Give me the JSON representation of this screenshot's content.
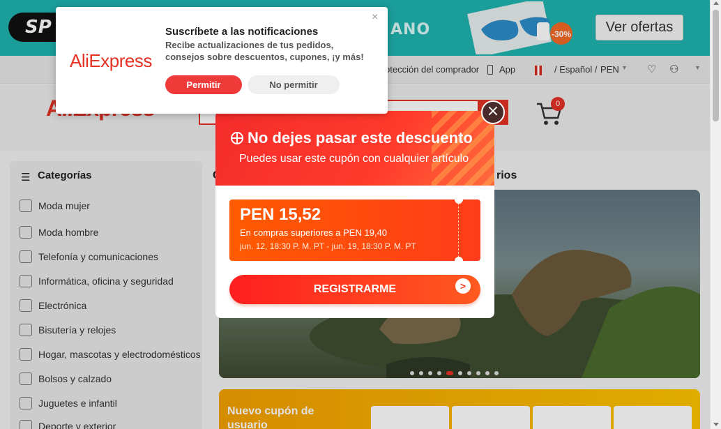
{
  "banner": {
    "pill_text": "SP",
    "promo_text": "ANO",
    "discount_badge": "-30%",
    "cta": "Ver ofertas"
  },
  "utility_bar": {
    "buyer_protection": "otección del comprador",
    "app": "App",
    "language_currency": "/ Español /",
    "currency": "PEN"
  },
  "header": {
    "logo": "AliExpress",
    "cart_count": "0"
  },
  "sidebar": {
    "title": "Categorías",
    "items": [
      {
        "label": "Moda mujer",
        "icon": "dress-icon"
      },
      {
        "label": "Moda hombre",
        "icon": "shirt-icon"
      },
      {
        "label": "Telefonía y comunicaciones",
        "icon": "phone-icon"
      },
      {
        "label": "Informática, oficina y seguridad",
        "icon": "laptop-icon"
      },
      {
        "label": "Electrónica",
        "icon": "camera-icon"
      },
      {
        "label": "Bisutería y relojes",
        "icon": "ring-icon"
      },
      {
        "label": "Hogar, mascotas y electrodomésticos",
        "icon": "sofa-icon"
      },
      {
        "label": "Bolsos y calzado",
        "icon": "bag-icon"
      },
      {
        "label": "Juguetes e infantil",
        "icon": "toy-icon"
      },
      {
        "label": "Deporte y exterior",
        "icon": "ball-icon"
      }
    ]
  },
  "main": {
    "section_title_left": "C",
    "section_title_right": "rios",
    "coupon_strip_title": "Nuevo cupón de usuario"
  },
  "notification": {
    "logo": "AliExpress",
    "title": "Suscríbete a las notificaciones",
    "body": "Recibe actualizaciones de tus pedidos, consejos sobre descuentos, cupones, ¡y más!",
    "allow": "Permitir",
    "deny": "No permitir",
    "close": "×"
  },
  "modal": {
    "title": "No dejes pasar este descuento",
    "subtitle": "Puedes usar este cupón con cualquier artículo",
    "coupon_amount": "PEN 15,52",
    "coupon_condition": "En compras superiores a PEN 19,40",
    "coupon_dates": "jun. 12, 18:30 P. M. PT - jun. 19, 18:30 P. M. PT",
    "register": "REGISTRARME",
    "register_arrow": ">",
    "close": "×"
  },
  "colors": {
    "brand_red": "#e43225",
    "banner_teal": "#1fb3b0"
  }
}
